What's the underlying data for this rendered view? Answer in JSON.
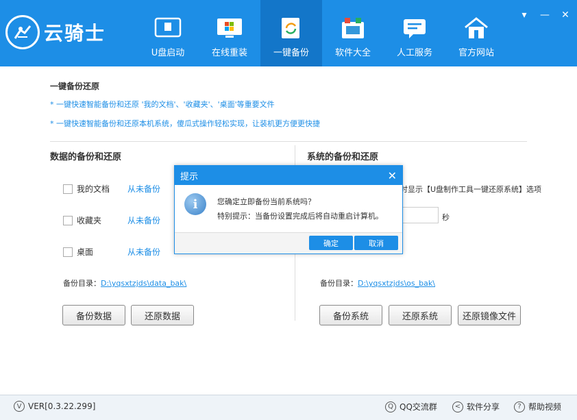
{
  "app": {
    "name": "云骑士"
  },
  "nav": [
    {
      "label": "U盘启动",
      "icon": "usb-icon"
    },
    {
      "label": "在线重装",
      "icon": "windows-icon"
    },
    {
      "label": "一键备份",
      "icon": "backup-icon"
    },
    {
      "label": "软件大全",
      "icon": "software-icon"
    },
    {
      "label": "人工服务",
      "icon": "chat-icon"
    },
    {
      "label": "官方网站",
      "icon": "home-icon"
    }
  ],
  "window": {
    "menu": "▾",
    "minimize": "—",
    "close": "✕"
  },
  "main": {
    "title": "一键备份还原",
    "note1": "* 一键快速智能备份和还原 '我的文档'、'收藏夹'、'桌面'等重要文件",
    "note2": "* 一键快速智能备份和还原本机系统，傻瓜式操作轻松实现，让装机更方便更快捷"
  },
  "data_backup": {
    "title": "数据的备份和还原",
    "items": [
      {
        "label": "我的文档",
        "status": "从未备份"
      },
      {
        "label": "收藏夹",
        "status": "从未备份"
      },
      {
        "label": "桌面",
        "status": "从未备份"
      }
    ],
    "dir_label": "备份目录：",
    "dir_path": "D:\\yqsxtzjds\\data_bak\\",
    "backup_btn": "备份数据",
    "restore_btn": "还原数据"
  },
  "sys_backup": {
    "title": "系统的备份和还原",
    "hint": "时显示【U盘制作工具一键还原系统】选项",
    "sec_unit": "秒",
    "dir_label": "备份目录：",
    "dir_path": "D:\\yqsxtzjds\\os_bak\\",
    "backup_btn": "备份系统",
    "restore_btn": "还原系统",
    "restore_image_btn": "还原镜像文件"
  },
  "dialog": {
    "title": "提示",
    "msg1": "您确定立即备份当前系统吗？",
    "msg2": "特别提示：当备份设置完成后将自动重启计算机。",
    "ok": "确定",
    "cancel": "取消",
    "close": "✕"
  },
  "footer": {
    "version": "VER[0.3.22.299]",
    "qq": "QQ交流群",
    "share": "软件分享",
    "help": "帮助视频"
  },
  "colors": {
    "primary": "#1d8ee6",
    "active_nav": "#1376c9"
  }
}
